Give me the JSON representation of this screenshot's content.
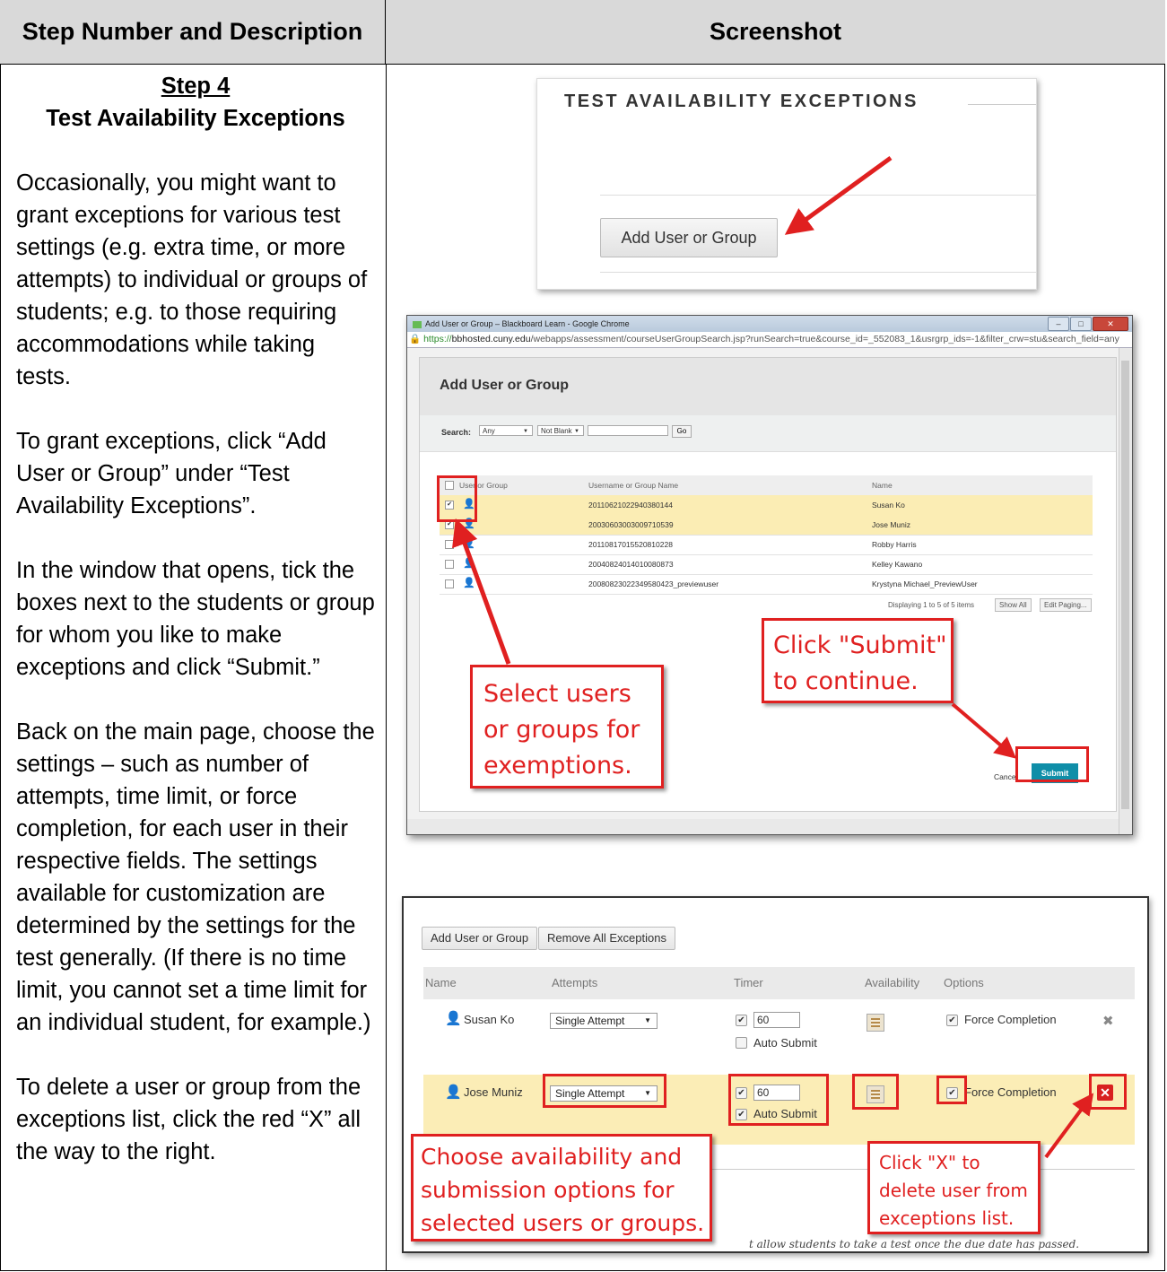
{
  "table": {
    "col1_header": "Step Number and Description",
    "col2_header": "Screenshot"
  },
  "step": {
    "number": "Step 4",
    "title": "Test Availability Exceptions",
    "paragraphs": [
      "Occasionally, you might want to grant exceptions for various test settings (e.g. extra time, or more attempts) to individual or groups of students; e.g. to those requiring accommodations while taking tests.",
      "To grant exceptions, click “Add User or Group” under “Test Availability Exceptions”.",
      "In the window that opens, tick the boxes next to the students or group for whom you like to make exceptions and click “Submit.”",
      "Back on the main page, choose the settings – such as number of attempts, time limit, or force completion, for each user in their respective fields. The settings available for customization are determined by the settings for the test generally. (If there is no time limit, you cannot set a time limit for an individual student, for example.)",
      "To delete a user or group from the exceptions list, click the red “X” all the way to the right."
    ]
  },
  "shot1": {
    "heading": "TEST AVAILABILITY EXCEPTIONS",
    "button": "Add User or Group"
  },
  "shot2": {
    "window_title": "Add User or Group – Blackboard Learn - Google Chrome",
    "url_scheme": "https://",
    "url_domain": "bbhosted.cuny.edu",
    "url_path": "/webapps/assessment/courseUserGroupSearch.jsp?runSearch=true&course_id=_552083_1&usrgrp_ids=-1&filter_crw=stu&search_field=any",
    "modal_title": "Add User or Group",
    "search_label": "Search:",
    "search_field": "Any",
    "search_op": "Not Blank",
    "go": "Go",
    "col_user_or_group": "User or Group",
    "col_username": "Username or Group Name",
    "col_name": "Name",
    "rows": [
      {
        "username": "20110621022940380144",
        "name": "Susan Ko",
        "checked": true
      },
      {
        "username": "20030603003009710539",
        "name": "Jose Muniz",
        "checked": true
      },
      {
        "username": "20110817015520810228",
        "name": "Robby Harris",
        "checked": false
      },
      {
        "username": "20040824014010080873",
        "name": "Kelley Kawano",
        "checked": false
      },
      {
        "username": "20080823022349580423_previewuser",
        "name": "Krystyna Michael_PreviewUser",
        "checked": false
      }
    ],
    "paging_text": "Displaying 1 to 5 of 5 items",
    "show_all": "Show All",
    "edit_paging": "Edit Paging...",
    "callout_select": "Select users or groups for exemptions.",
    "callout_submit": "Click \"Submit\" to continue.",
    "cancel": "Cancel",
    "submit": "Submit"
  },
  "shot3": {
    "add_button": "Add User or Group",
    "remove_button": "Remove All Exceptions",
    "col_name": "Name",
    "col_attempts": "Attempts",
    "col_timer": "Timer",
    "col_availability": "Availability",
    "col_options": "Options",
    "rows": [
      {
        "name": "Susan Ko",
        "attempts": "Single Attempt",
        "timer": "60",
        "timer_checked": true,
        "auto_submit": "Auto Submit",
        "auto_checked": false,
        "force": "Force Completion",
        "force_checked": true
      },
      {
        "name": "Jose Muniz",
        "attempts": "Single Attempt",
        "timer": "60",
        "timer_checked": true,
        "auto_submit": "Auto Submit",
        "auto_checked": true,
        "force": "Force Completion",
        "force_checked": true
      }
    ],
    "callout_choose": "Choose availability and submission options for selected users or groups.",
    "callout_delete": "Click \"X\" to delete user from exceptions list.",
    "footnote_fragment": "t allow students to take a test once the due date has passed."
  },
  "colors": {
    "header_bg": "#d9d9d9",
    "callout_red": "#e02020",
    "submit_blue": "#0f8ea8",
    "highlight_row": "#fbedb4"
  }
}
